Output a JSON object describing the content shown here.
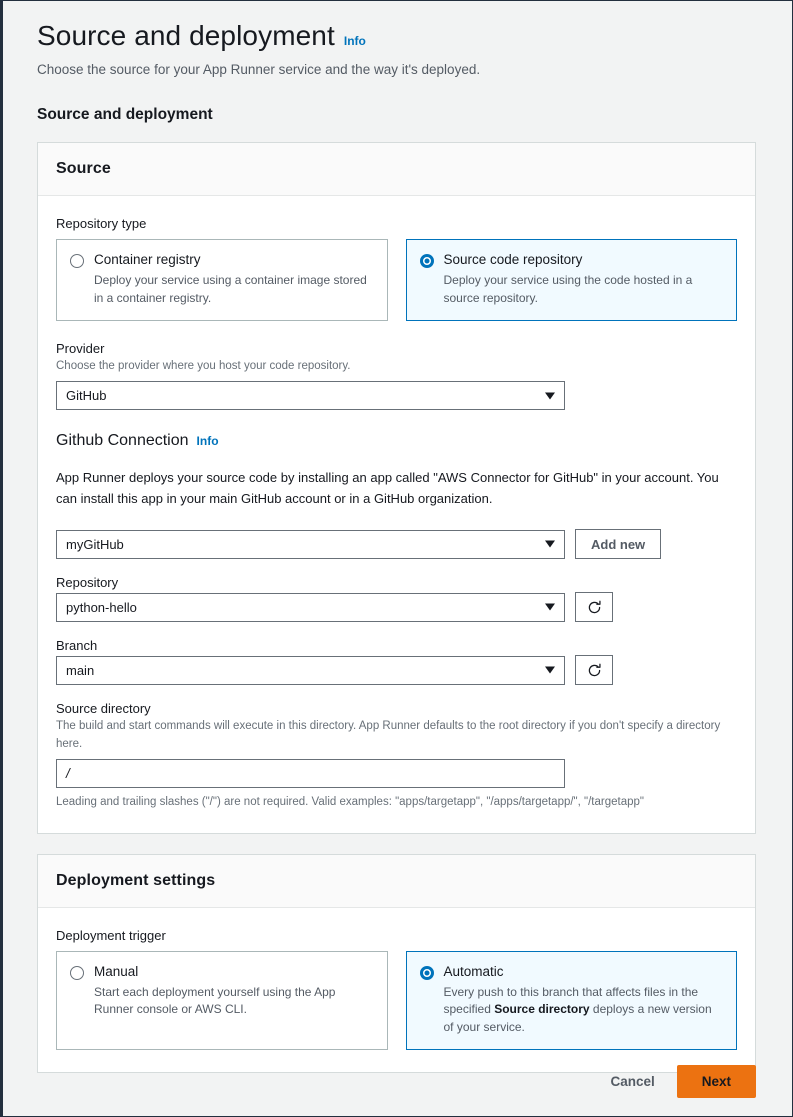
{
  "header": {
    "title": "Source and deployment",
    "info_label": "Info",
    "subtitle": "Choose the source for your App Runner service and the way it's deployed.",
    "section_heading": "Source and deployment"
  },
  "source_card": {
    "title": "Source",
    "repository_type": {
      "label": "Repository type",
      "options": [
        {
          "title": "Container registry",
          "desc": "Deploy your service using a container image stored in a container registry.",
          "selected": false
        },
        {
          "title": "Source code repository",
          "desc": "Deploy your service using the code hosted in a source repository.",
          "selected": true
        }
      ]
    },
    "provider": {
      "label": "Provider",
      "desc": "Choose the provider where you host your code repository.",
      "value": "GitHub"
    },
    "github_connection": {
      "heading": "Github Connection",
      "info_label": "Info",
      "paragraph": "App Runner deploys your source code by installing an app called \"AWS Connector for GitHub\" in your account. You can install this app in your main GitHub account or in a GitHub organization.",
      "connection_value": "myGitHub",
      "add_new_label": "Add new"
    },
    "repository": {
      "label": "Repository",
      "value": "python-hello"
    },
    "branch": {
      "label": "Branch",
      "value": "main"
    },
    "source_directory": {
      "label": "Source directory",
      "desc": "The build and start commands will execute in this directory. App Runner defaults to the root directory if you don't specify a directory here.",
      "value": "/",
      "hint": "Leading and trailing slashes (\"/\") are not required. Valid examples: \"apps/targetapp\", \"/apps/targetapp/\", \"/targetapp\""
    }
  },
  "deployment_card": {
    "title": "Deployment settings",
    "deployment_trigger": {
      "label": "Deployment trigger",
      "options": [
        {
          "title": "Manual",
          "desc": "Start each deployment yourself using the App Runner console or AWS CLI.",
          "selected": false
        },
        {
          "title": "Automatic",
          "desc_before": "Every push to this branch that affects files in the specified ",
          "desc_bold": "Source directory",
          "desc_after": " deploys a new version of your service.",
          "selected": true
        }
      ]
    }
  },
  "footer": {
    "cancel_label": "Cancel",
    "next_label": "Next"
  },
  "colors": {
    "accent_blue": "#0073bb",
    "primary_orange": "#ec7211",
    "selected_tile_bg": "#f1faff",
    "page_bg": "#f2f3f3"
  }
}
